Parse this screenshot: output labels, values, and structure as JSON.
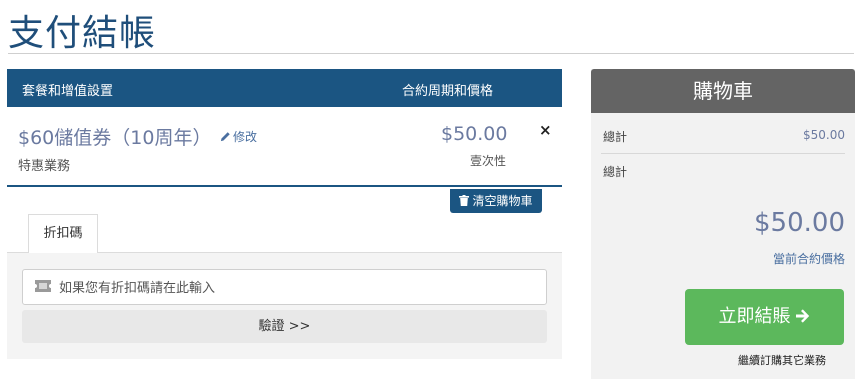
{
  "page": {
    "title": "支付結帳"
  },
  "cart_table": {
    "col_product": "套餐和增值設置",
    "col_cycle": "合約周期和價格",
    "items": [
      {
        "name": "$60儲值券（10周年）",
        "edit_label": "修改",
        "group": "特惠業務",
        "price": "$50.00",
        "cycle": "壹次性",
        "remove_symbol": "×"
      }
    ],
    "empty_cart_label": "清空購物車"
  },
  "promo": {
    "tab_label": "折扣碼",
    "input_placeholder": "如果您有折扣碼請在此輸入",
    "input_value": "",
    "validate_label": "驗證 >>"
  },
  "summary": {
    "title": "購物車",
    "subtotal_label": "總計",
    "subtotal_value": "$50.00",
    "total_label": "總計",
    "total_value": "$50.00",
    "total_note": "當前合約價格",
    "checkout_label": "立即結賬",
    "continue_label": "繼續訂購其它業務"
  },
  "colors": {
    "header_blue": "#1b5582",
    "title_blue": "#1f4e7a",
    "price_blue": "#6b7aa0",
    "summary_header": "#646464",
    "checkout_green": "#5cb85c"
  },
  "icons": [
    "pencil-icon",
    "close-icon",
    "trash-icon",
    "ticket-icon",
    "arrow-right-icon"
  ]
}
